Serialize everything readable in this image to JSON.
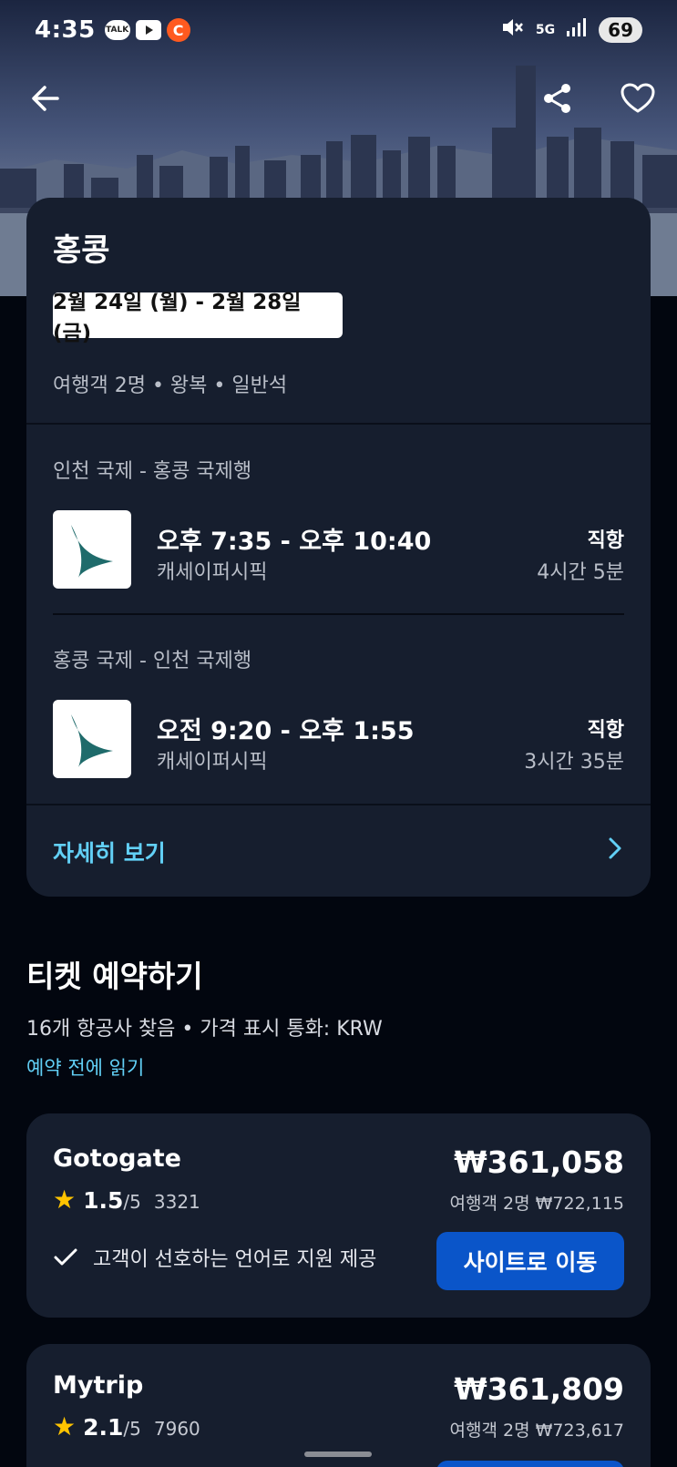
{
  "status_bar": {
    "time": "4:35",
    "apps": [
      "TALK",
      "YouTube",
      "C"
    ],
    "network": "5G",
    "battery": "69"
  },
  "nav": {
    "back_icon": "arrow-left-icon",
    "share_icon": "share-icon",
    "favorite_icon": "heart-icon"
  },
  "trip": {
    "destination": "홍콩",
    "dates": "2월 24일 (월) - 2월 28일 (금)",
    "meta": "여행객 2명 • 왕복 • 일반석",
    "legs": [
      {
        "route": "인천 국제 - 홍콩 국제행",
        "time": "오후 7:35 - 오후 10:40",
        "airline": "캐세이퍼시픽",
        "stops": "직항",
        "duration": "4시간 5분"
      },
      {
        "route": "홍콩 국제 - 인천 국제행",
        "time": "오전 9:20 - 오후 1:55",
        "airline": "캐세이퍼시픽",
        "stops": "직항",
        "duration": "3시간 35분"
      }
    ],
    "details_label": "자세히 보기"
  },
  "booking": {
    "title": "티켓 예약하기",
    "meta": "16개 항공사 찾음 • 가격 표시 통화: KRW",
    "read_before": "예약 전에 읽기",
    "providers": [
      {
        "name": "Gotogate",
        "rating": "1.5",
        "rating_max": "/5",
        "reviews": "3321",
        "price": "₩361,058",
        "total": "여행객 2명 ₩722,115",
        "feature": "고객이 선호하는 언어로 지원 제공",
        "button": "사이트로 이동"
      },
      {
        "name": "Mytrip",
        "rating": "2.1",
        "rating_max": "/5",
        "reviews": "7960",
        "price": "₩361,809",
        "total": "여행객 2명 ₩723,617"
      }
    ]
  },
  "colors": {
    "background": "#02060f",
    "card": "#161e2e",
    "link": "#62d0f6",
    "primary_button": "#0a55c9",
    "star": "#ffc400"
  }
}
